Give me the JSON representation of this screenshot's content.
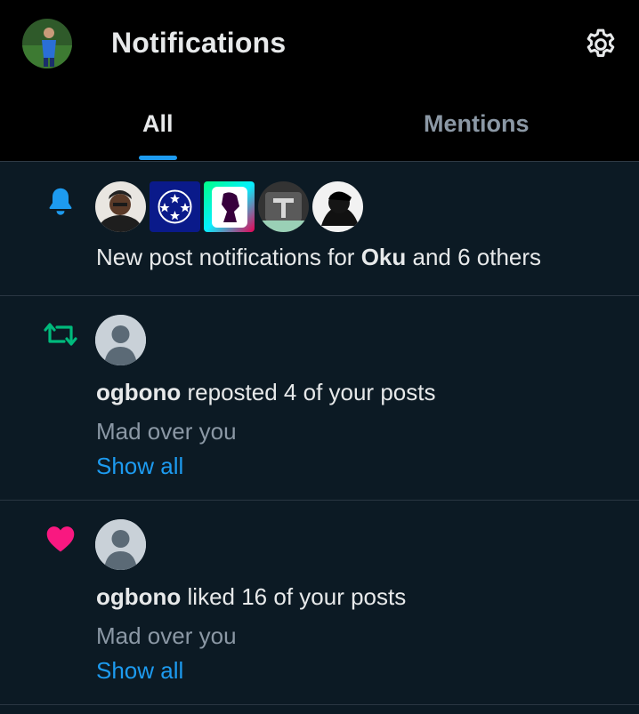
{
  "header": {
    "title": "Notifications",
    "tabs": [
      {
        "label": "All",
        "active": true
      },
      {
        "label": "Mentions",
        "active": false
      }
    ]
  },
  "notifications": [
    {
      "type": "new-post",
      "icon": "bell-icon",
      "prefix": "New post notifications for ",
      "name": "Oku",
      "suffix": " and 6 others"
    },
    {
      "type": "repost",
      "icon": "repost-icon",
      "user": "ogbono",
      "action": " reposted 4 of your posts",
      "preview": "Mad over you",
      "link": "Show all"
    },
    {
      "type": "like",
      "icon": "heart-icon",
      "user": "ogbono",
      "action": " liked 16 of your posts",
      "preview": "Mad over you",
      "link": "Show all"
    }
  ],
  "colors": {
    "accent": "#1d9bf0",
    "repost": "#00ba7c",
    "like": "#f91880",
    "background": "#0c1a24"
  }
}
